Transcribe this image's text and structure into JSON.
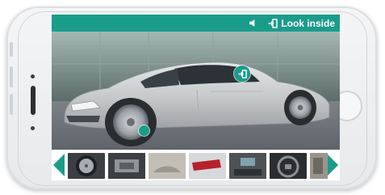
{
  "header": {
    "look_inside_label": "Look inside"
  },
  "colors": {
    "accent": "#1a9c8b",
    "car_body": "#c9ccce",
    "background_building": "#6f8a86"
  },
  "icons": {
    "sound": "speaker-icon",
    "enter": "enter-icon",
    "prev": "chevron-left-icon",
    "next": "chevron-right-icon"
  },
  "thumbnails": [
    {
      "label": "wheel"
    },
    {
      "label": "engine"
    },
    {
      "label": "interior"
    },
    {
      "label": "tail-light"
    },
    {
      "label": "dashboard"
    },
    {
      "label": "steering-wheel"
    },
    {
      "label": "seat"
    }
  ]
}
